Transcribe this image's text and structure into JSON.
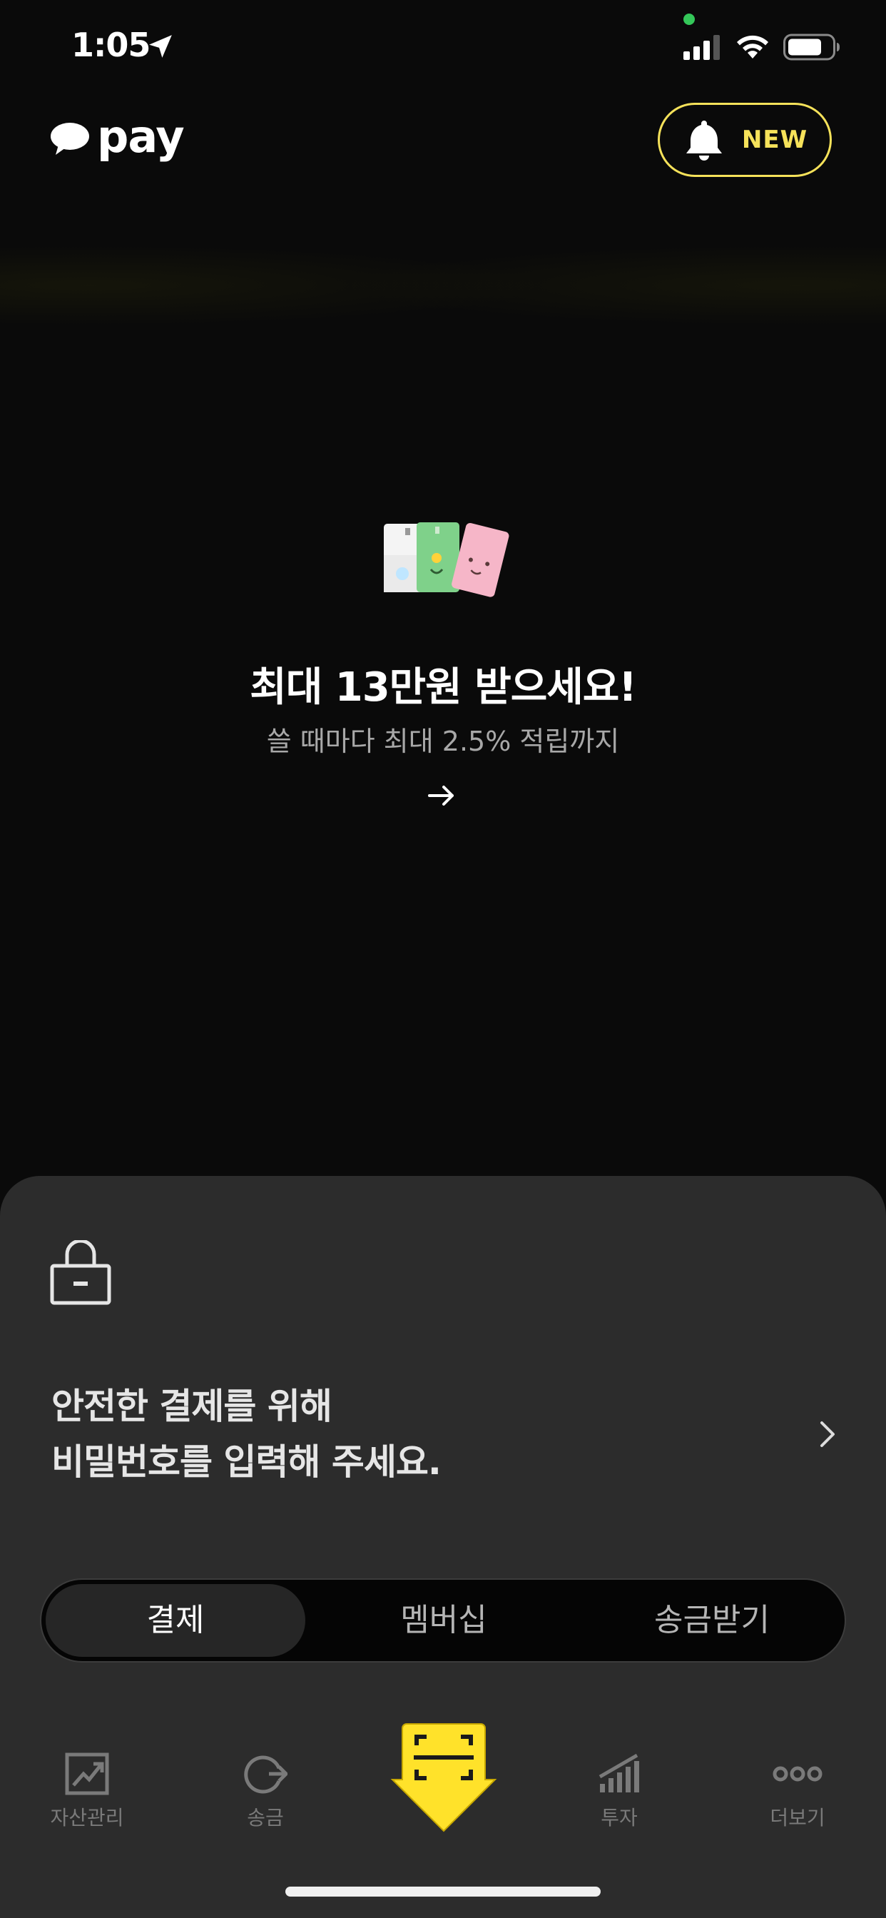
{
  "status_bar": {
    "time": "1:05"
  },
  "header": {
    "logo_text": "pay",
    "notification_badge": "NEW"
  },
  "promo": {
    "title": "최대 13만원 받으세요!",
    "subtitle": "쓸 때마다 최대 2.5% 적립까지"
  },
  "password_prompt": {
    "line1": "안전한 결제를 위해",
    "line2": "비밀번호를 입력해 주세요."
  },
  "segmented_tabs": [
    {
      "label": "결제",
      "active": true
    },
    {
      "label": "멤버십",
      "active": false
    },
    {
      "label": "송금받기",
      "active": false
    }
  ],
  "bottom_nav": [
    {
      "label": "자산관리",
      "icon": "chart-frame-icon"
    },
    {
      "label": "송금",
      "icon": "transfer-icon"
    },
    {
      "label": "",
      "icon": "scan-pay-icon"
    },
    {
      "label": "투자",
      "icon": "bars-growth-icon"
    },
    {
      "label": "더보기",
      "icon": "more-dots-icon"
    }
  ],
  "colors": {
    "accent": "#f6e25a",
    "background": "#0a0a0a",
    "sheet": "#2c2c2c",
    "scan_button": "#ffe22a"
  }
}
